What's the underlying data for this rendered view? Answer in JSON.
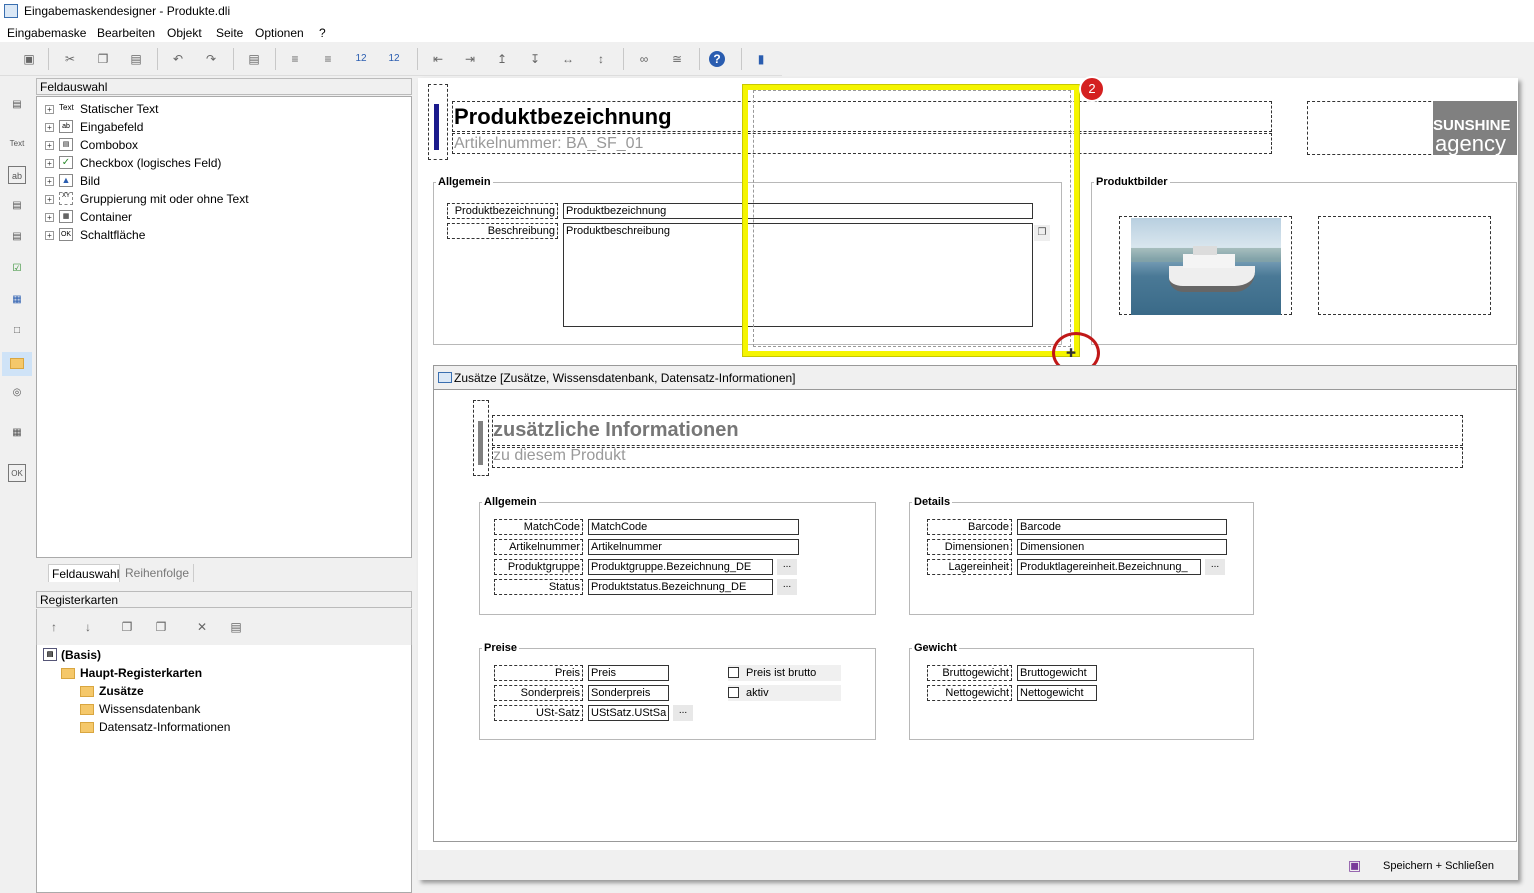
{
  "window": {
    "title": "Eingabemaskendesigner - Produkte.dli"
  },
  "menu": [
    "Eingabemaske",
    "Bearbeiten",
    "Objekt",
    "Seite",
    "Optionen",
    "?"
  ],
  "toolbar": {
    "num1": "12",
    "num2": "12"
  },
  "leftstrip": {
    "text": "Text",
    "ab": "ab",
    "ok": "OK"
  },
  "feldauswahl": {
    "header": "Feldauswahl",
    "items": [
      {
        "label": "Statischer Text",
        "icon": "Text"
      },
      {
        "label": "Eingabefeld",
        "icon": "ab"
      },
      {
        "label": "Combobox",
        "icon": ""
      },
      {
        "label": "Checkbox (logisches Feld)",
        "icon": ""
      },
      {
        "label": "Bild",
        "icon": ""
      },
      {
        "label": "Gruppierung mit oder ohne Text",
        "icon": "XY"
      },
      {
        "label": "Container",
        "icon": ""
      },
      {
        "label": "Schaltfläche",
        "icon": "OK"
      }
    ],
    "tabs": [
      "Feldauswahl",
      "Reihenfolge"
    ]
  },
  "registerkarten": {
    "header": "Registerkarten",
    "tree": [
      {
        "label": "(Basis)"
      },
      {
        "label": "Haupt-Registerkarten"
      },
      {
        "label": "Zusätze"
      },
      {
        "label": "Wissensdatenbank"
      },
      {
        "label": "Datensatz-Informationen"
      }
    ]
  },
  "header": {
    "title": "Produktbezeichnung",
    "subtitle": "Artikelnummer: BA_SF_01",
    "logo_line1": "SUNSHINE",
    "logo_line2": "agency"
  },
  "allgemein_top": {
    "label": "Allgemein",
    "fields": [
      {
        "label": "Produktbezeichnung",
        "value": "Produktbezeichnung"
      },
      {
        "label": "Beschreibung",
        "value": "Produktbeschreibung"
      }
    ]
  },
  "produktbilder": {
    "label": "Produktbilder"
  },
  "badge": "2",
  "tabpanel": {
    "title": "Zusätze [Zusätze, Wissensdatenbank, Datensatz-Informationen]"
  },
  "zusatz_header": {
    "title": "zusätzliche Informationen",
    "subtitle": "zu diesem Produkt"
  },
  "allgemein2": {
    "label": "Allgemein",
    "fields": [
      {
        "label": "MatchCode",
        "value": "MatchCode"
      },
      {
        "label": "Artikelnummer",
        "value": "Artikelnummer"
      },
      {
        "label": "Produktgruppe",
        "value": "Produktgruppe.Bezeichnung_DE"
      },
      {
        "label": "Status",
        "value": "Produktstatus.Bezeichnung_DE"
      }
    ]
  },
  "details": {
    "label": "Details",
    "fields": [
      {
        "label": "Barcode",
        "value": "Barcode"
      },
      {
        "label": "Dimensionen",
        "value": "Dimensionen"
      },
      {
        "label": "Lagereinheit",
        "value": "Produktlagereinheit.Bezeichnung_"
      }
    ]
  },
  "preise": {
    "label": "Preise",
    "fields": [
      {
        "label": "Preis",
        "value": "Preis"
      },
      {
        "label": "Sonderpreis",
        "value": "Sonderpreis"
      },
      {
        "label": "USt-Satz",
        "value": "UStSatz.UStSa"
      }
    ],
    "checkboxes": [
      "Preis ist brutto",
      "aktiv"
    ]
  },
  "gewicht": {
    "label": "Gewicht",
    "fields": [
      {
        "label": "Bruttogewicht",
        "value": "Bruttogewicht"
      },
      {
        "label": "Nettogewicht",
        "value": "Nettogewicht"
      }
    ]
  },
  "dots": "...",
  "footer": {
    "save_label": "Speichern + Schließen"
  },
  "colors": {
    "highlight": "#f5f500",
    "accent_bar": "#1a1a8c",
    "badge": "#d42020"
  }
}
